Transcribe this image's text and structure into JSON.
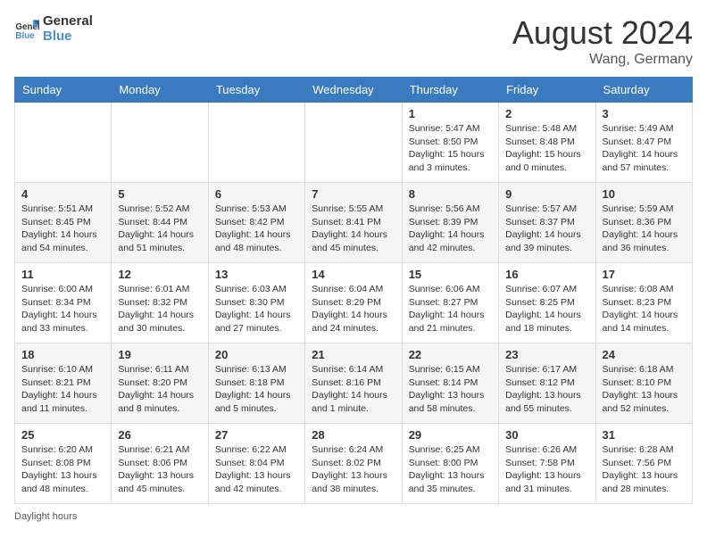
{
  "header": {
    "logo_line1": "General",
    "logo_line2": "Blue",
    "month_year": "August 2024",
    "location": "Wang, Germany"
  },
  "days_of_week": [
    "Sunday",
    "Monday",
    "Tuesday",
    "Wednesday",
    "Thursday",
    "Friday",
    "Saturday"
  ],
  "weeks": [
    [
      {
        "day": "",
        "info": ""
      },
      {
        "day": "",
        "info": ""
      },
      {
        "day": "",
        "info": ""
      },
      {
        "day": "",
        "info": ""
      },
      {
        "day": "1",
        "info": "Sunrise: 5:47 AM\nSunset: 8:50 PM\nDaylight: 15 hours\nand 3 minutes."
      },
      {
        "day": "2",
        "info": "Sunrise: 5:48 AM\nSunset: 8:48 PM\nDaylight: 15 hours\nand 0 minutes."
      },
      {
        "day": "3",
        "info": "Sunrise: 5:49 AM\nSunset: 8:47 PM\nDaylight: 14 hours\nand 57 minutes."
      }
    ],
    [
      {
        "day": "4",
        "info": "Sunrise: 5:51 AM\nSunset: 8:45 PM\nDaylight: 14 hours\nand 54 minutes."
      },
      {
        "day": "5",
        "info": "Sunrise: 5:52 AM\nSunset: 8:44 PM\nDaylight: 14 hours\nand 51 minutes."
      },
      {
        "day": "6",
        "info": "Sunrise: 5:53 AM\nSunset: 8:42 PM\nDaylight: 14 hours\nand 48 minutes."
      },
      {
        "day": "7",
        "info": "Sunrise: 5:55 AM\nSunset: 8:41 PM\nDaylight: 14 hours\nand 45 minutes."
      },
      {
        "day": "8",
        "info": "Sunrise: 5:56 AM\nSunset: 8:39 PM\nDaylight: 14 hours\nand 42 minutes."
      },
      {
        "day": "9",
        "info": "Sunrise: 5:57 AM\nSunset: 8:37 PM\nDaylight: 14 hours\nand 39 minutes."
      },
      {
        "day": "10",
        "info": "Sunrise: 5:59 AM\nSunset: 8:36 PM\nDaylight: 14 hours\nand 36 minutes."
      }
    ],
    [
      {
        "day": "11",
        "info": "Sunrise: 6:00 AM\nSunset: 8:34 PM\nDaylight: 14 hours\nand 33 minutes."
      },
      {
        "day": "12",
        "info": "Sunrise: 6:01 AM\nSunset: 8:32 PM\nDaylight: 14 hours\nand 30 minutes."
      },
      {
        "day": "13",
        "info": "Sunrise: 6:03 AM\nSunset: 8:30 PM\nDaylight: 14 hours\nand 27 minutes."
      },
      {
        "day": "14",
        "info": "Sunrise: 6:04 AM\nSunset: 8:29 PM\nDaylight: 14 hours\nand 24 minutes."
      },
      {
        "day": "15",
        "info": "Sunrise: 6:06 AM\nSunset: 8:27 PM\nDaylight: 14 hours\nand 21 minutes."
      },
      {
        "day": "16",
        "info": "Sunrise: 6:07 AM\nSunset: 8:25 PM\nDaylight: 14 hours\nand 18 minutes."
      },
      {
        "day": "17",
        "info": "Sunrise: 6:08 AM\nSunset: 8:23 PM\nDaylight: 14 hours\nand 14 minutes."
      }
    ],
    [
      {
        "day": "18",
        "info": "Sunrise: 6:10 AM\nSunset: 8:21 PM\nDaylight: 14 hours\nand 11 minutes."
      },
      {
        "day": "19",
        "info": "Sunrise: 6:11 AM\nSunset: 8:20 PM\nDaylight: 14 hours\nand 8 minutes."
      },
      {
        "day": "20",
        "info": "Sunrise: 6:13 AM\nSunset: 8:18 PM\nDaylight: 14 hours\nand 5 minutes."
      },
      {
        "day": "21",
        "info": "Sunrise: 6:14 AM\nSunset: 8:16 PM\nDaylight: 14 hours\nand 1 minute."
      },
      {
        "day": "22",
        "info": "Sunrise: 6:15 AM\nSunset: 8:14 PM\nDaylight: 13 hours\nand 58 minutes."
      },
      {
        "day": "23",
        "info": "Sunrise: 6:17 AM\nSunset: 8:12 PM\nDaylight: 13 hours\nand 55 minutes."
      },
      {
        "day": "24",
        "info": "Sunrise: 6:18 AM\nSunset: 8:10 PM\nDaylight: 13 hours\nand 52 minutes."
      }
    ],
    [
      {
        "day": "25",
        "info": "Sunrise: 6:20 AM\nSunset: 8:08 PM\nDaylight: 13 hours\nand 48 minutes."
      },
      {
        "day": "26",
        "info": "Sunrise: 6:21 AM\nSunset: 8:06 PM\nDaylight: 13 hours\nand 45 minutes."
      },
      {
        "day": "27",
        "info": "Sunrise: 6:22 AM\nSunset: 8:04 PM\nDaylight: 13 hours\nand 42 minutes."
      },
      {
        "day": "28",
        "info": "Sunrise: 6:24 AM\nSunset: 8:02 PM\nDaylight: 13 hours\nand 38 minutes."
      },
      {
        "day": "29",
        "info": "Sunrise: 6:25 AM\nSunset: 8:00 PM\nDaylight: 13 hours\nand 35 minutes."
      },
      {
        "day": "30",
        "info": "Sunrise: 6:26 AM\nSunset: 7:58 PM\nDaylight: 13 hours\nand 31 minutes."
      },
      {
        "day": "31",
        "info": "Sunrise: 6:28 AM\nSunset: 7:56 PM\nDaylight: 13 hours\nand 28 minutes."
      }
    ]
  ],
  "footer": {
    "note": "Daylight hours"
  }
}
